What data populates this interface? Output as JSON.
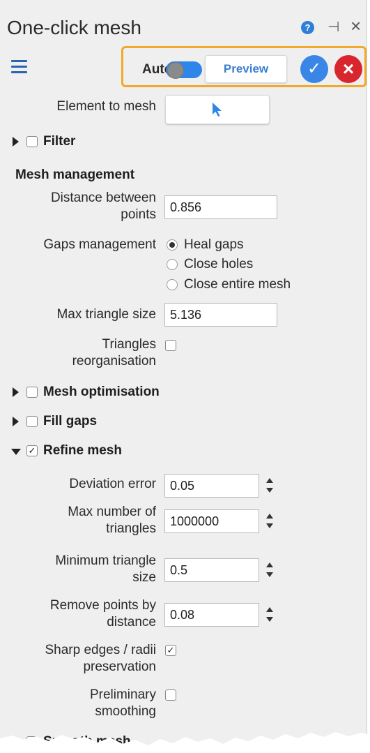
{
  "window": {
    "title": "One-click mesh"
  },
  "toolbar": {
    "auto_label": "Auto",
    "preview_label": "Preview",
    "auto_enabled": true
  },
  "fields": {
    "element_to_mesh": "Element to mesh",
    "filter": "Filter",
    "mesh_management": "Mesh management",
    "distance_between_points": {
      "label_1": "Distance between",
      "label_2": "points",
      "value": "0.856"
    },
    "gaps_management": {
      "label": "Gaps management",
      "options": [
        "Heal gaps",
        "Close holes",
        "Close entire mesh"
      ],
      "selected": "Heal gaps"
    },
    "max_triangle_size": {
      "label": "Max triangle size",
      "value": "5.136"
    },
    "triangles_reorganisation": {
      "label_1": "Triangles",
      "label_2": "reorganisation",
      "checked": false
    }
  },
  "sections": {
    "mesh_optimisation": {
      "label": "Mesh optimisation",
      "checked": false
    },
    "fill_gaps": {
      "label": "Fill gaps",
      "checked": false
    },
    "refine_mesh": {
      "label": "Refine mesh",
      "checked": true
    },
    "smooth_mesh": {
      "label": "Smooth mesh",
      "checked": true
    }
  },
  "refine": {
    "deviation_error": {
      "label": "Deviation error",
      "value": "0.05"
    },
    "max_number_of_triangles": {
      "label_1": "Max number of",
      "label_2": "triangles",
      "value": "1000000"
    },
    "minimum_triangle_size": {
      "label_1": "Minimum triangle",
      "label_2": "size",
      "value": "0.5"
    },
    "remove_points_by_distance": {
      "label_1": "Remove points by",
      "label_2": "distance",
      "value": "0.08"
    },
    "sharp_edges": {
      "label_1": "Sharp edges / radii",
      "label_2": "preservation",
      "checked": true
    },
    "preliminary_smoothing": {
      "label_1": "Preliminary",
      "label_2": "smoothing",
      "checked": false
    }
  },
  "icons": {
    "help": "help-circle-icon",
    "pin": "pin-icon",
    "close": "close-icon",
    "menu": "hamburger-icon",
    "ok": "checkmark-icon",
    "cancel": "x-icon",
    "cursor": "pointer-cursor-icon"
  },
  "colors": {
    "accent": "#2f86ea",
    "highlight_border": "#f0a92a",
    "cancel": "#d8262f"
  }
}
